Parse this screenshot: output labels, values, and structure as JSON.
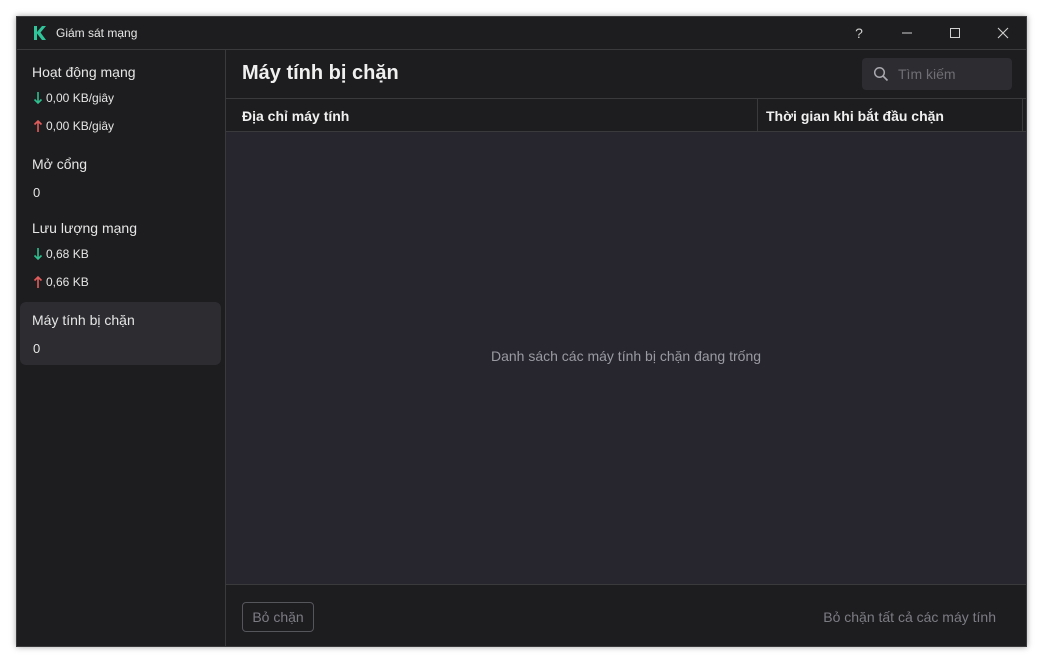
{
  "window": {
    "title": "Giám sát mạng"
  },
  "titlebar": {
    "help_label": "?"
  },
  "sidebar": {
    "network_activity": {
      "label": "Hoạt động mạng",
      "download": "0,00 KB/giây",
      "upload": "0,00 KB/giây"
    },
    "open_ports": {
      "label": "Mở cổng",
      "value": "0"
    },
    "network_traffic": {
      "label": "Lưu lượng mạng",
      "download": "0,68 KB",
      "upload": "0,66 KB"
    },
    "blocked_computers": {
      "label": "Máy tính bị chặn",
      "value": "0"
    }
  },
  "main": {
    "title": "Máy tính bị chặn",
    "search": {
      "placeholder": "Tìm kiếm"
    },
    "table": {
      "columns": [
        "Địa chỉ máy tính",
        "Thời gian khi bắt đầu chặn"
      ],
      "empty_message": "Danh sách các máy tính bị chặn đang trống"
    },
    "footer": {
      "unblock_label": "Bỏ chặn",
      "unblock_all_label": "Bỏ chặn tất cả các máy tính"
    }
  },
  "colors": {
    "brand": "#2fc49a",
    "download_arrow": "#2fbf8f",
    "upload_arrow": "#e25c5c",
    "background": "#1d1d1f"
  },
  "icons": {
    "logo": "kaspersky-k-icon",
    "search": "search-icon",
    "help": "help-icon",
    "minimize": "minimize-icon",
    "maximize": "maximize-icon",
    "close": "close-icon"
  }
}
